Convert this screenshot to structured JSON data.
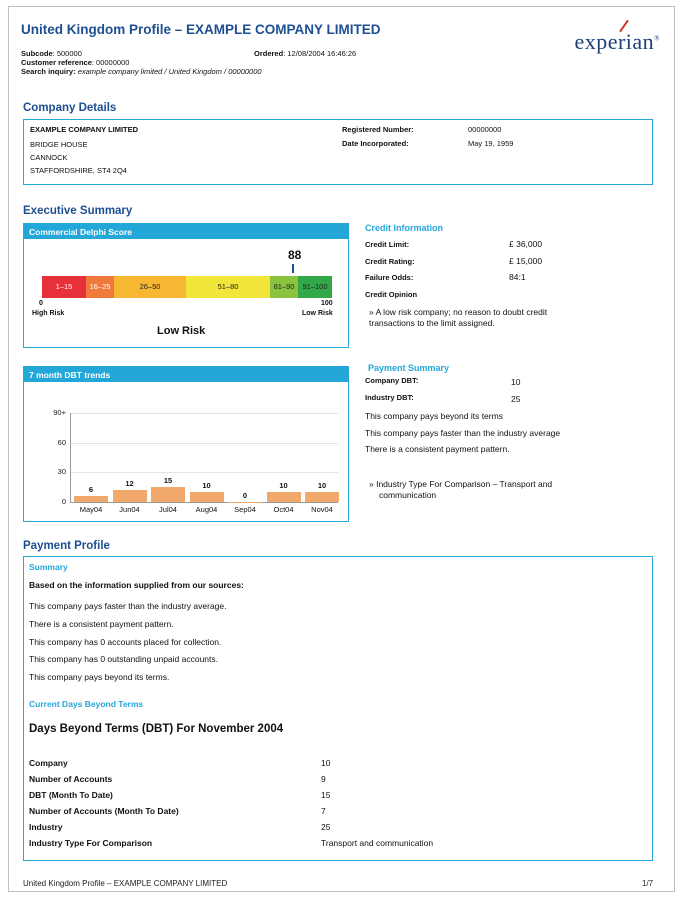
{
  "header": {
    "title": "United Kingdom Profile – EXAMPLE COMPANY LIMITED",
    "subcode_label": "Subcode",
    "subcode_value": ": 500000",
    "ordered_label": "Ordered",
    "ordered_value": ": 12/08/2004 16:46:26",
    "customer_ref_label": "Customer reference",
    "customer_ref_value": ": 00000000",
    "search_label": "Search inquiry:",
    "search_value": "example company limited / United Kingdom / 00000000",
    "logo_text": "experian",
    "logo_mark": "®"
  },
  "company_details": {
    "section_title": "Company Details",
    "name": "EXAMPLE COMPANY LIMITED",
    "address": [
      "BRIDGE HOUSE",
      "CANNOCK",
      "STAFFORDSHIRE,  ST4 2Q4"
    ],
    "reg_number_label": "Registered Number:",
    "reg_number_value": "00000000",
    "date_inc_label": "Date Incorporated:",
    "date_inc_value": "May 19, 1959"
  },
  "executive_summary": {
    "section_title": "Executive Summary",
    "delphi": {
      "header": "Commercial Delphi Score",
      "score": "88",
      "score_value": 88,
      "segments": [
        {
          "label": "1–15",
          "color": "#e8303a",
          "text_color": "#ffffff"
        },
        {
          "label": "16–25",
          "color": "#f07a3c",
          "text_color": "#ffffff"
        },
        {
          "label": "26–50",
          "color": "#f7b733",
          "text_color": "#222222"
        },
        {
          "label": "51–80",
          "color": "#f3e63a",
          "text_color": "#222222"
        },
        {
          "label": "81–90",
          "color": "#8ac43f",
          "text_color": "#222222"
        },
        {
          "label": "91–100",
          "color": "#33a84a",
          "text_color": "#222222"
        }
      ],
      "low_num": "0",
      "low_label": "High Risk",
      "high_num": "100",
      "high_label": "Low Risk",
      "risk_text": "Low Risk"
    },
    "credit_info": {
      "title": "Credit Information",
      "limit_label": "Credit Limit:",
      "limit_value": "£ 36,000",
      "rating_label": "Credit Rating:",
      "rating_value": "£ 15,000",
      "failure_label": "Failure Odds:",
      "failure_value": "84:1",
      "opinion_label": "Credit Opinion",
      "opinion_line1": "»  A low risk company; no reason to doubt credit",
      "opinion_line2": "transactions to the limit assigned."
    },
    "dbt_trends": {
      "header": "7 month DBT trends",
      "y_ticks": [
        "90+",
        "60",
        "30",
        "0"
      ]
    },
    "payment_summary": {
      "title": "Payment Summary",
      "company_dbt_label": "Company DBT:",
      "company_dbt_value": "10",
      "industry_dbt_label": "Industry DBT:",
      "industry_dbt_value": "25",
      "lines": [
        "This company pays beyond its terms",
        "This company pays faster than the industry average",
        "There is a consistent payment pattern."
      ],
      "industry_type_line1": "»  Industry Type For Comparison – Transport and",
      "industry_type_line2": "communication"
    }
  },
  "chart_data": {
    "type": "bar",
    "title": "7 month DBT trends",
    "categories": [
      "May04",
      "Jun04",
      "Jul04",
      "Aug04",
      "Sep04",
      "Oct04",
      "Nov04"
    ],
    "values": [
      6,
      12,
      15,
      10,
      0,
      10,
      10
    ],
    "value_labels": [
      "6",
      "12",
      "15",
      "10",
      "0",
      "10",
      "10"
    ],
    "y_ticks": [
      "90+",
      "60",
      "30",
      "0"
    ],
    "ylim": [
      0,
      90
    ],
    "bar_color": "#f0a96a",
    "grid": true
  },
  "payment_profile": {
    "section_title": "Payment Profile",
    "summary_title": "Summary",
    "intro": "Based on the information supplied from our sources:",
    "lines": [
      "This company pays faster than the industry average.",
      "There is a consistent payment pattern.",
      "This company has 0 accounts placed for collection.",
      "This company has 0 outstanding unpaid accounts.",
      "This company pays beyond its terms."
    ],
    "cdbt_title": "Current Days Beyond Terms",
    "dbt_heading": "Days Beyond Terms (DBT) For November 2004",
    "rows": [
      {
        "label": "Company",
        "value": "10"
      },
      {
        "label": "Number of Accounts",
        "value": "9"
      },
      {
        "label": "DBT (Month To Date)",
        "value": "15"
      },
      {
        "label": "Number of Accounts (Month To Date)",
        "value": "7"
      },
      {
        "label": "Industry",
        "value": "25"
      },
      {
        "label": "Industry Type For Comparison",
        "value": "Transport and communication"
      }
    ]
  },
  "footer": {
    "left": "United Kingdom Profile – EXAMPLE COMPANY LIMITED",
    "right": "1/7"
  }
}
